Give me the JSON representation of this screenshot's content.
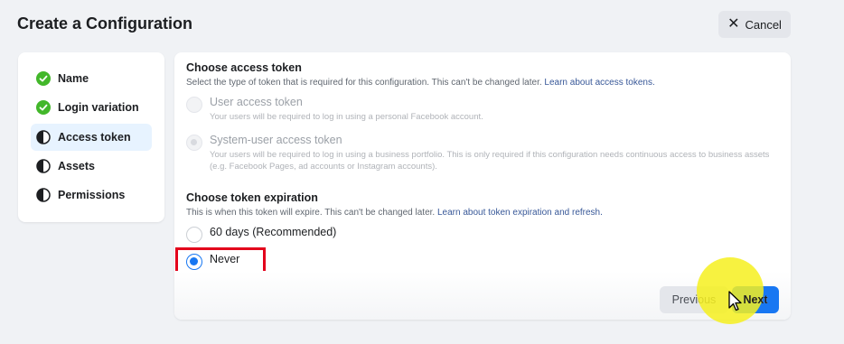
{
  "header": {
    "title": "Create a Configuration",
    "cancel_label": "Cancel"
  },
  "steps": [
    {
      "label": "Name",
      "status": "complete"
    },
    {
      "label": "Login variation",
      "status": "complete"
    },
    {
      "label": "Access token",
      "status": "current"
    },
    {
      "label": "Assets",
      "status": "pending"
    },
    {
      "label": "Permissions",
      "status": "pending"
    }
  ],
  "access_token": {
    "title": "Choose access token",
    "description": "Select the type of token that is required for this configuration. This can't be changed later.",
    "link": "Learn about access tokens.",
    "options": [
      {
        "label": "User access token",
        "description": "Your users will be required to log in using a personal Facebook account.",
        "selected": false,
        "disabled": true
      },
      {
        "label": "System-user access token",
        "description": "Your users will be required to log in using a business portfolio. This is only required if this configuration needs continuous access to business assets (e.g. Facebook Pages, ad accounts or Instagram accounts).",
        "selected": true,
        "disabled": true
      }
    ]
  },
  "expiration": {
    "title": "Choose token expiration",
    "description": "This is when this token will expire. This can't be changed later.",
    "link": "Learn about token expiration and refresh.",
    "options": [
      {
        "label": "60 days (Recommended)",
        "selected": false
      },
      {
        "label": "Never",
        "selected": true
      }
    ]
  },
  "footer": {
    "previous_label": "Previous",
    "next_label": "Next"
  },
  "colors": {
    "accent": "#1877f2",
    "complete": "#42b72a",
    "highlight": "#e3001b",
    "cursor_glow": "#f6f01e"
  },
  "icons": {
    "cancel": "close-icon",
    "complete": "check-circle-icon",
    "current": "half-circle-icon",
    "pending": "half-circle-icon"
  }
}
